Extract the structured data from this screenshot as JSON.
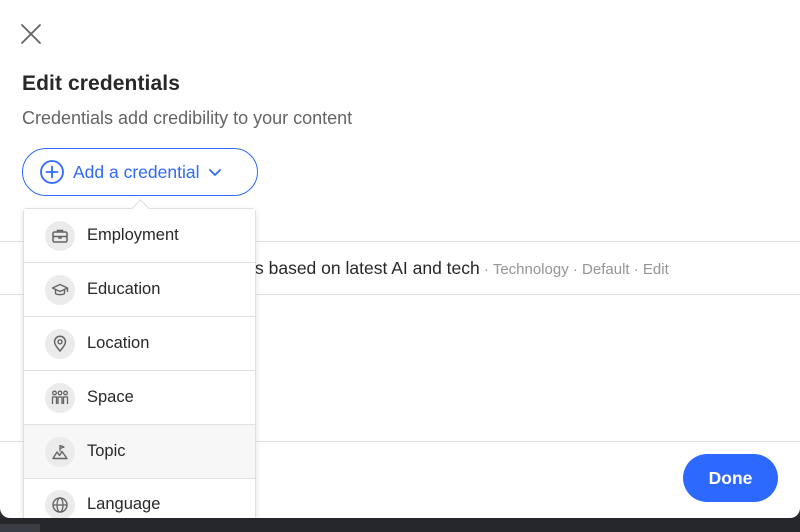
{
  "modal": {
    "close_icon": "close-icon",
    "title": "Edit credentials",
    "subtitle": "Credentials add credibility to your content"
  },
  "add_credential": {
    "label": "Add a credential",
    "icon": "plus-circle-icon",
    "chevron": "chevron-down-icon"
  },
  "dropdown": {
    "items": [
      {
        "label": "Employment",
        "icon": "briefcase-icon"
      },
      {
        "label": "Education",
        "icon": "graduation-cap-icon"
      },
      {
        "label": "Location",
        "icon": "map-pin-icon"
      },
      {
        "label": "Space",
        "icon": "people-group-icon"
      },
      {
        "label": "Topic",
        "icon": "topic-icon"
      },
      {
        "label": "Language",
        "icon": "globe-icon"
      }
    ]
  },
  "credential_row": {
    "text": "s based on latest AI and tech",
    "separator": " · ",
    "topic": "Technology",
    "status": "Default",
    "edit": "Edit"
  },
  "footer": {
    "done_label": "Done"
  },
  "colors": {
    "accent": "#2e69ff",
    "text": "#282829",
    "muted": "#636466",
    "meta": "#939598",
    "divider": "#dee0e1"
  }
}
